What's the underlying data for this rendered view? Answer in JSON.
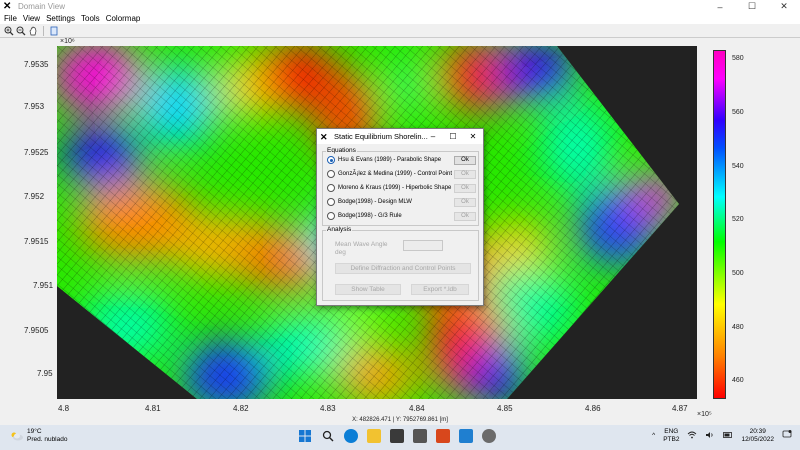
{
  "window": {
    "title": "Domain View",
    "minimize": "–",
    "maximize": "☐",
    "close": "✕"
  },
  "menu": [
    "File",
    "View",
    "Settings",
    "Tools",
    "Colormap"
  ],
  "plot": {
    "y_exponent": "×10⁶",
    "x_exponent": "×10⁵",
    "y_ticks": [
      "7.9535",
      "7.953",
      "7.9525",
      "7.952",
      "7.9515",
      "7.951",
      "7.9505",
      "7.95"
    ],
    "x_ticks": [
      "4.8",
      "4.81",
      "4.82",
      "4.83",
      "4.84",
      "4.85",
      "4.86",
      "4.87"
    ],
    "colorbar_ticks": [
      "580",
      "560",
      "540",
      "520",
      "500",
      "480",
      "460"
    ],
    "coord_readout": "X: 482826.471 | Y: 7952769.861 [m]"
  },
  "dialog": {
    "title": "Static Equilibrium Shorelin...",
    "minimize": "–",
    "maximize": "☐",
    "close": "✕",
    "equations_title": "Equations",
    "equations": [
      {
        "label": "Hsu & Evans (1989) - Parabolic Shape",
        "button": "Ok",
        "selected": true,
        "enabled": true
      },
      {
        "label": "GonzÃ¡lez & Medina (1999) - Control Point",
        "button": "Ok",
        "selected": false,
        "enabled": false
      },
      {
        "label": "Moreno & Kraus (1999) - Hiperbolic Shape",
        "button": "Ok",
        "selected": false,
        "enabled": false
      },
      {
        "label": "Bodge(1998) - Design MLW",
        "button": "Ok",
        "selected": false,
        "enabled": false
      },
      {
        "label": "Bodge(1998) - G/3 Rule",
        "button": "Ok",
        "selected": false,
        "enabled": false
      }
    ],
    "analysis_title": "Analysis",
    "mean_wave_angle_label": "Mean Wave Angle",
    "mean_wave_angle_unit": "deg",
    "mean_wave_angle_value": "",
    "define_button": "Define Diffraction and Control Points",
    "show_table_button": "Show Table",
    "export_button": "Export *.ldb"
  },
  "taskbar": {
    "temperature": "19°C",
    "weather_text": "Pred. nublado",
    "language_1": "ENG",
    "language_2": "PTB2",
    "time": "20:39",
    "date": "12/05/2022"
  }
}
